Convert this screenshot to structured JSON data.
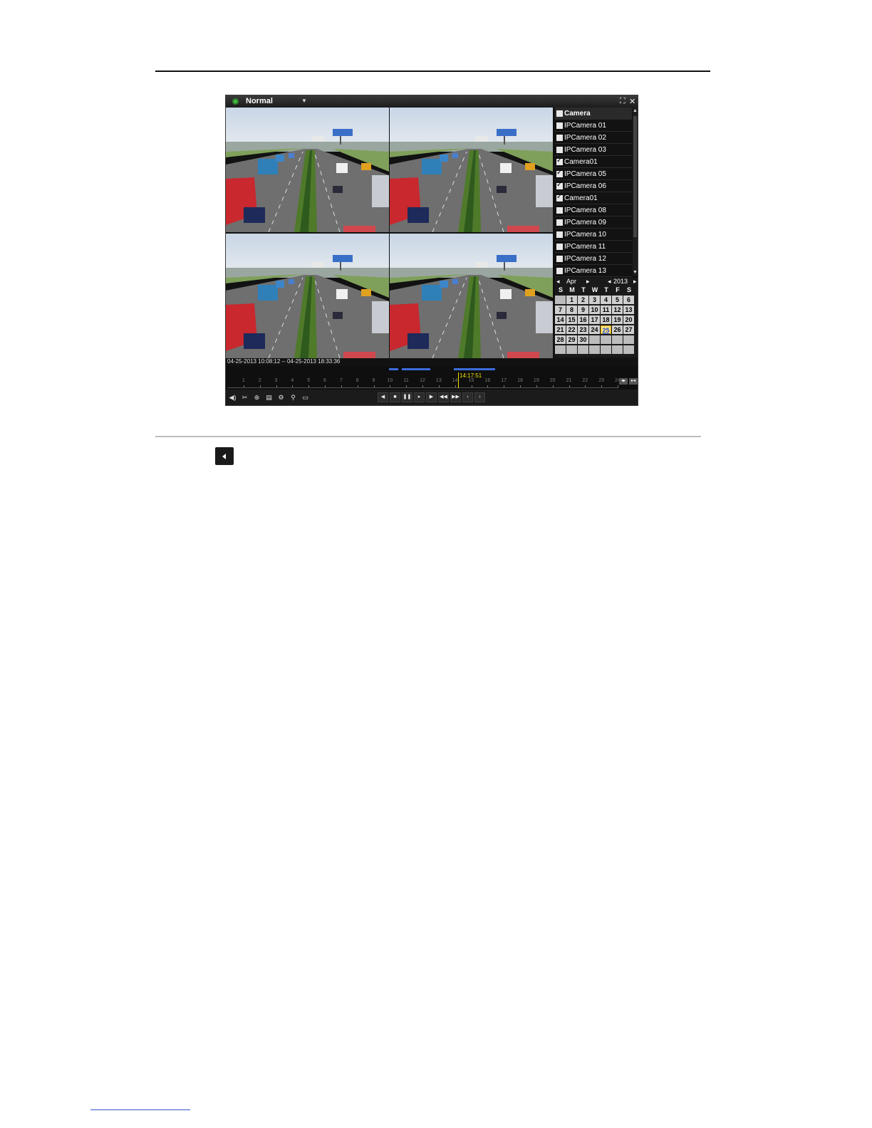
{
  "window": {
    "mode_label": "Normal",
    "mode_arrow_icon": "chevron-down-icon",
    "fullscreen_icon": "fullscreen-icon",
    "close_icon": "close-icon"
  },
  "camera_list": {
    "header": {
      "label": "Camera",
      "checked": false
    },
    "items": [
      {
        "label": "IPCamera 01",
        "checked": false
      },
      {
        "label": "IPCamera 02",
        "checked": false
      },
      {
        "label": "IPCamera 03",
        "checked": false
      },
      {
        "label": "Camera01",
        "checked": true
      },
      {
        "label": "IPCamera 05",
        "checked": true
      },
      {
        "label": "IPCamera 06",
        "checked": true
      },
      {
        "label": "Camera01",
        "checked": true
      },
      {
        "label": "IPCamera 08",
        "checked": false
      },
      {
        "label": "IPCamera 09",
        "checked": false
      },
      {
        "label": "IPCamera 10",
        "checked": false
      },
      {
        "label": "IPCamera 11",
        "checked": false
      },
      {
        "label": "IPCamera 12",
        "checked": false
      },
      {
        "label": "IPCamera 13",
        "checked": false
      }
    ]
  },
  "calendar": {
    "month": "Apr",
    "year": "2013",
    "weekdays": [
      "S",
      "M",
      "T",
      "W",
      "T",
      "F",
      "S"
    ],
    "days": [
      "",
      "1",
      "2",
      "3",
      "4",
      "5",
      "6",
      "7",
      "8",
      "9",
      "10",
      "11",
      "12",
      "13",
      "14",
      "15",
      "16",
      "17",
      "18",
      "19",
      "20",
      "21",
      "22",
      "23",
      "24",
      "25",
      "26",
      "27",
      "28",
      "29",
      "30",
      "",
      "",
      "",
      "",
      "",
      "",
      "",
      "",
      "",
      "",
      ""
    ],
    "selected_day": "25"
  },
  "timeline": {
    "time_range": "04-25-2013 10:08:12 -- 04-25-2013 18:33:36",
    "cursor_time": "14:17:51",
    "hour_labels": [
      "1",
      "2",
      "3",
      "4",
      "5",
      "6",
      "7",
      "8",
      "9",
      "10",
      "11",
      "12",
      "13",
      "14",
      "15",
      "16",
      "17",
      "18",
      "19",
      "20",
      "21",
      "22",
      "23",
      "24"
    ]
  },
  "colors": {
    "record_bar": "#3b6ddc",
    "cursor": "#f0e000",
    "mode_indicator": "#3fbf3f"
  },
  "toolbar": {
    "left_icons": [
      "audio-icon",
      "clip-icon",
      "tag-icon",
      "custom-tag-icon",
      "tag-manage-icon",
      "digital-zoom-icon",
      "smart-search-icon"
    ],
    "playback_icons": [
      "reverse-play-icon",
      "stop-icon",
      "pause-icon",
      "slow-forward-icon",
      "fast-forward-icon",
      "rewind-30s-icon",
      "forward-30s-icon",
      "previous-day-icon",
      "next-day-icon"
    ]
  }
}
